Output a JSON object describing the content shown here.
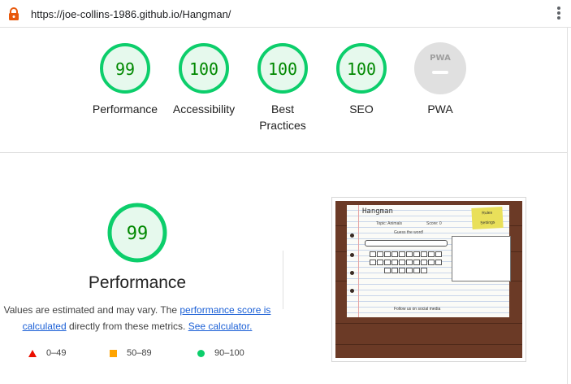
{
  "browser": {
    "url": "https://joe-collins-1986.github.io/Hangman/",
    "lock_icon": "lock-icon",
    "menu_icon": "vertical-dots-icon"
  },
  "summary": {
    "gauges": [
      {
        "label": "Performance",
        "score": "99"
      },
      {
        "label": "Accessibility",
        "score": "100"
      },
      {
        "label": "Best Practices",
        "score": "100"
      },
      {
        "label": "SEO",
        "score": "100"
      },
      {
        "label": "PWA",
        "score": "PWA"
      }
    ]
  },
  "performance": {
    "score": "99",
    "title": "Performance",
    "desc_prefix": "Values are estimated and may vary. The ",
    "score_link": "performance score is calculated",
    "desc_middle": " directly from these metrics. ",
    "calc_link": "See calculator."
  },
  "legend": [
    {
      "range": "0–49",
      "shape": "triangle",
      "color": "#eb0f00"
    },
    {
      "range": "50–89",
      "shape": "square",
      "color": "#ffa400"
    },
    {
      "range": "90–100",
      "shape": "circle",
      "color": "#0cce6b"
    }
  ],
  "colors": {
    "pass": "#0cce6b",
    "pass_fill": "#e6f9ed",
    "pass_text": "#008800",
    "pwa_gray": "#e0e0e0",
    "link": "#1a5fd6"
  },
  "thumbnail": {
    "title": "Hangman",
    "topic": "Topic: Animals",
    "score": "Score: 0",
    "prompt": "Guess the word!",
    "sticky_line1": "Rules",
    "sticky_line2": "Settings",
    "social": "Follow us on social media"
  }
}
